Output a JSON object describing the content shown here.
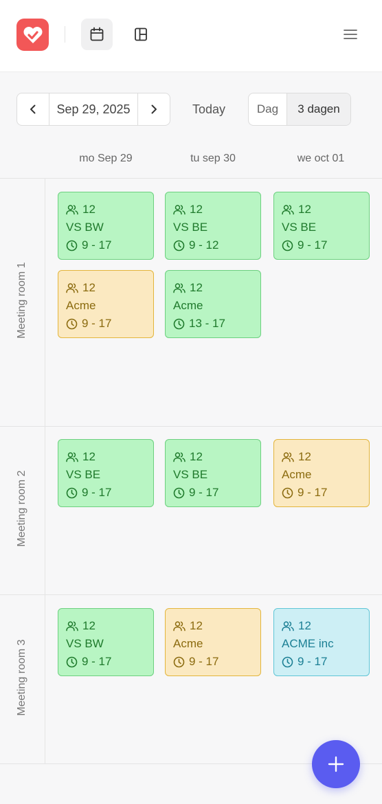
{
  "header": {
    "logo_icon": "heart-check-logo",
    "calendar_view_icon": "calendar-icon",
    "board_view_icon": "board-icon",
    "menu_icon": "hamburger-menu-icon"
  },
  "toolbar": {
    "current_date": "Sep 29, 2025",
    "today_label": "Today",
    "view_options": [
      "Dag",
      "3 dagen"
    ],
    "selected_view": "3 dagen"
  },
  "days": [
    "mo Sep 29",
    "tu sep 30",
    "we oct 01"
  ],
  "rooms": [
    {
      "name": "Meeting room 1",
      "events": [
        {
          "day": 0,
          "slot": 0,
          "people": "12",
          "title": "VS BW",
          "time": "9 - 17",
          "color": "green"
        },
        {
          "day": 1,
          "slot": 0,
          "people": "12",
          "title": "VS BE",
          "time": "9 - 12",
          "color": "green"
        },
        {
          "day": 2,
          "slot": 0,
          "people": "12",
          "title": "VS BE",
          "time": "9 - 17",
          "color": "green"
        },
        {
          "day": 0,
          "slot": 1,
          "people": "12",
          "title": "Acme",
          "time": "9 - 17",
          "color": "yellow"
        },
        {
          "day": 1,
          "slot": 1,
          "people": "12",
          "title": "Acme",
          "time": "13 - 17",
          "color": "green"
        }
      ]
    },
    {
      "name": "Meeting room 2",
      "events": [
        {
          "day": 0,
          "slot": 0,
          "people": "12",
          "title": "VS BE",
          "time": "9 - 17",
          "color": "green"
        },
        {
          "day": 1,
          "slot": 0,
          "people": "12",
          "title": "VS BE",
          "time": "9 - 17",
          "color": "green"
        },
        {
          "day": 2,
          "slot": 0,
          "people": "12",
          "title": "Acme",
          "time": "9 - 17",
          "color": "yellow"
        }
      ]
    },
    {
      "name": "Meeting room 3",
      "events": [
        {
          "day": 0,
          "slot": 0,
          "people": "12",
          "title": "VS BW",
          "time": "9 - 17",
          "color": "green"
        },
        {
          "day": 1,
          "slot": 0,
          "people": "12",
          "title": "Acme",
          "time": "9 - 17",
          "color": "yellow"
        },
        {
          "day": 2,
          "slot": 0,
          "people": "12",
          "title": "ACME inc",
          "time": "9 - 17",
          "color": "blue"
        }
      ]
    }
  ],
  "fab": {
    "icon": "plus-icon"
  },
  "colors": {
    "brand": "#f25757",
    "accent": "#5a5cf0",
    "green": "#b8f5c3",
    "yellow": "#fbe9c1",
    "blue": "#cdeff5"
  }
}
